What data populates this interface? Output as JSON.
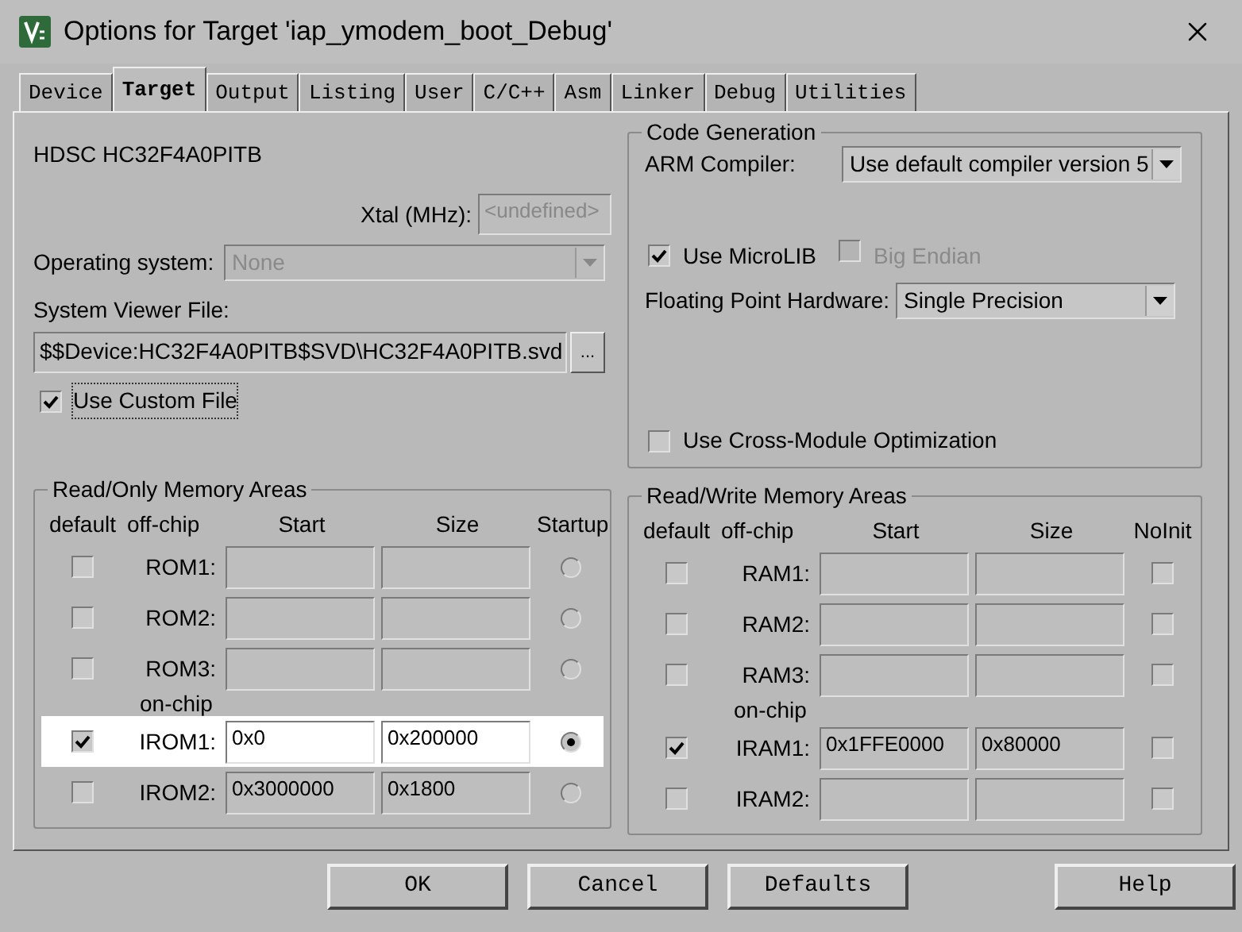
{
  "window": {
    "title": "Options for Target 'iap_ymodem_boot_Debug'"
  },
  "tabs": [
    {
      "label": "Device",
      "selected": false
    },
    {
      "label": "Target",
      "selected": true
    },
    {
      "label": "Output",
      "selected": false
    },
    {
      "label": "Listing",
      "selected": false
    },
    {
      "label": "User",
      "selected": false
    },
    {
      "label": "C/C++",
      "selected": false
    },
    {
      "label": "Asm",
      "selected": false
    },
    {
      "label": "Linker",
      "selected": false
    },
    {
      "label": "Debug",
      "selected": false
    },
    {
      "label": "Utilities",
      "selected": false
    }
  ],
  "device": {
    "name": "HDSC HC32F4A0PITB"
  },
  "xtal": {
    "label": "Xtal (MHz):",
    "value": "<undefined>",
    "disabled": true
  },
  "operating_system": {
    "label": "Operating system:",
    "value": "None",
    "disabled": true
  },
  "system_viewer_file": {
    "label": "System Viewer File:",
    "value": "$$Device:HC32F4A0PITB$SVD\\HC32F4A0PITB.svd",
    "browse": "..."
  },
  "use_custom_file": {
    "label": "Use Custom File",
    "checked": true
  },
  "code_generation": {
    "title": "Code Generation",
    "arm_compiler": {
      "label": "ARM Compiler:",
      "value": "Use default compiler version 5"
    },
    "use_microlib": {
      "label": "Use MicroLIB",
      "checked": true,
      "disabled": false
    },
    "big_endian": {
      "label": "Big Endian",
      "checked": false,
      "disabled": true
    },
    "floating_point": {
      "label": "Floating Point Hardware:",
      "value": "Single Precision"
    },
    "cross_module": {
      "label": "Use Cross-Module Optimization",
      "checked": false,
      "disabled": false
    }
  },
  "rom_areas": {
    "title": "Read/Only Memory Areas",
    "columns": [
      "default",
      "off-chip",
      "Start",
      "Size",
      "Startup"
    ],
    "onchip_label": "on-chip",
    "offchip_rows": [
      {
        "label": "ROM1:",
        "default": false,
        "selected": false,
        "highlighted": false
      },
      {
        "label": "ROM2:",
        "default": false,
        "selected": false,
        "highlighted": false
      },
      {
        "label": "ROM3:",
        "default": false,
        "selected": false,
        "highlighted": false
      }
    ],
    "onchip_rows": [
      {
        "label": "IROM1:",
        "default": true,
        "start": "0x0",
        "size": "0x200000",
        "selected": true,
        "highlighted": true
      },
      {
        "label": "IROM2:",
        "default": false,
        "start": "0x3000000",
        "size": "0x1800",
        "selected": false,
        "highlighted": false
      }
    ]
  },
  "ram_areas": {
    "title": "Read/Write Memory Areas",
    "columns": [
      "default",
      "off-chip",
      "Start",
      "Size",
      "NoInit"
    ],
    "onchip_label": "on-chip",
    "offchip_rows": [
      {
        "label": "RAM1:",
        "default": false,
        "noinit": false
      },
      {
        "label": "RAM2:",
        "default": false,
        "noinit": false
      },
      {
        "label": "RAM3:",
        "default": false,
        "noinit": false
      }
    ],
    "onchip_rows": [
      {
        "label": "IRAM1:",
        "default": true,
        "start": "0x1FFE0000",
        "size": "0x80000",
        "noinit": false
      },
      {
        "label": "IRAM2:",
        "default": false,
        "noinit": false
      }
    ]
  },
  "buttons": [
    {
      "label": "OK"
    },
    {
      "label": "Cancel"
    },
    {
      "label": "Defaults"
    },
    {
      "label": "Help"
    }
  ]
}
